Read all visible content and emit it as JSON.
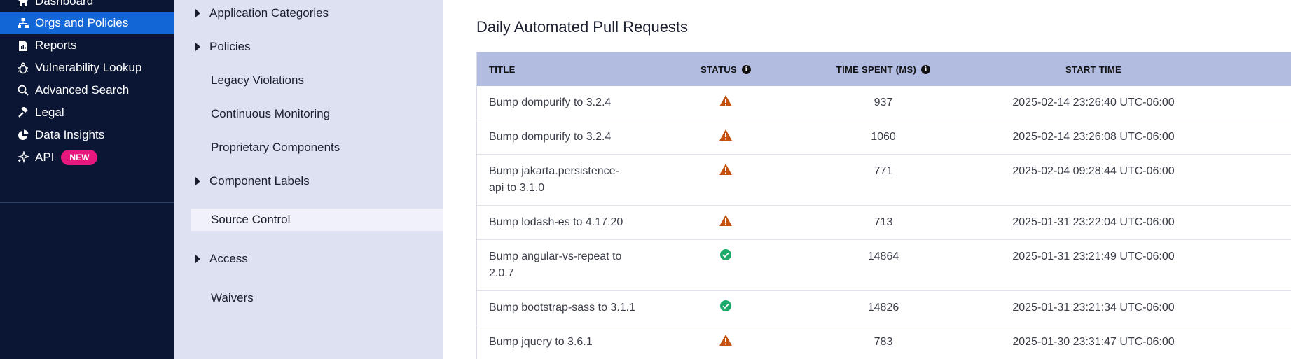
{
  "leftnav": {
    "items": [
      {
        "label": "Dashboard",
        "icon": "home-icon"
      },
      {
        "label": "Orgs and Policies",
        "icon": "sitemap-icon"
      },
      {
        "label": "Reports",
        "icon": "report-icon"
      },
      {
        "label": "Vulnerability Lookup",
        "icon": "bug-icon"
      },
      {
        "label": "Advanced Search",
        "icon": "search-icon"
      },
      {
        "label": "Legal",
        "icon": "gavel-icon"
      },
      {
        "label": "Data Insights",
        "icon": "pie-chart-icon"
      },
      {
        "label": "API",
        "icon": "sparkle-icon",
        "badge": "NEW"
      }
    ],
    "active_index": 1,
    "colors": {
      "background": "#0a1633",
      "active": "#1366d6",
      "badge": "#e6187d"
    }
  },
  "subnav": {
    "items": [
      {
        "label": "Application Categories",
        "expandable": true
      },
      {
        "label": "Policies",
        "expandable": true
      },
      {
        "label": "Legacy Violations",
        "expandable": false
      },
      {
        "label": "Continuous Monitoring",
        "expandable": false
      },
      {
        "label": "Proprietary Components",
        "expandable": false
      },
      {
        "label": "Component Labels",
        "expandable": true
      },
      {
        "label": "Source Control",
        "expandable": false,
        "selected": true
      },
      {
        "label": "Access",
        "expandable": true
      },
      {
        "label": "Waivers",
        "expandable": false
      }
    ],
    "colors": {
      "background": "#dde1f2",
      "selected": "#f1f2f9"
    }
  },
  "main": {
    "title": "Daily Automated Pull Requests",
    "table": {
      "headers": {
        "title": "TITLE",
        "status": "STATUS",
        "time_spent": "TIME SPENT (MS)",
        "start_time": "START TIME"
      },
      "header_info_icon": "info-icon",
      "rows": [
        {
          "title": "Bump dompurify to 3.2.4",
          "status": "warning",
          "time_spent": "937",
          "start_time": "2025-02-14 23:26:40 UTC-06:00"
        },
        {
          "title": "Bump dompurify to 3.2.4",
          "status": "warning",
          "time_spent": "1060",
          "start_time": "2025-02-14 23:26:08 UTC-06:00"
        },
        {
          "title": "Bump jakarta.persistence-api to 3.1.0",
          "status": "warning",
          "time_spent": "771",
          "start_time": "2025-02-04 09:28:44 UTC-06:00"
        },
        {
          "title": "Bump lodash-es to 4.17.20",
          "status": "warning",
          "time_spent": "713",
          "start_time": "2025-01-31 23:22:04 UTC-06:00"
        },
        {
          "title": "Bump angular-vs-repeat to 2.0.7",
          "status": "success",
          "time_spent": "14864",
          "start_time": "2025-01-31 23:21:49 UTC-06:00"
        },
        {
          "title": "Bump bootstrap-sass to 3.1.1",
          "status": "success",
          "time_spent": "14826",
          "start_time": "2025-01-31 23:21:34 UTC-06:00"
        },
        {
          "title": "Bump jquery to 3.6.1",
          "status": "warning",
          "time_spent": "783",
          "start_time": "2025-01-30 23:31:47 UTC-06:00"
        }
      ],
      "colors": {
        "header_bg": "#b2bce0",
        "warning": "#c4510e",
        "success": "#1eaa6a"
      }
    }
  }
}
